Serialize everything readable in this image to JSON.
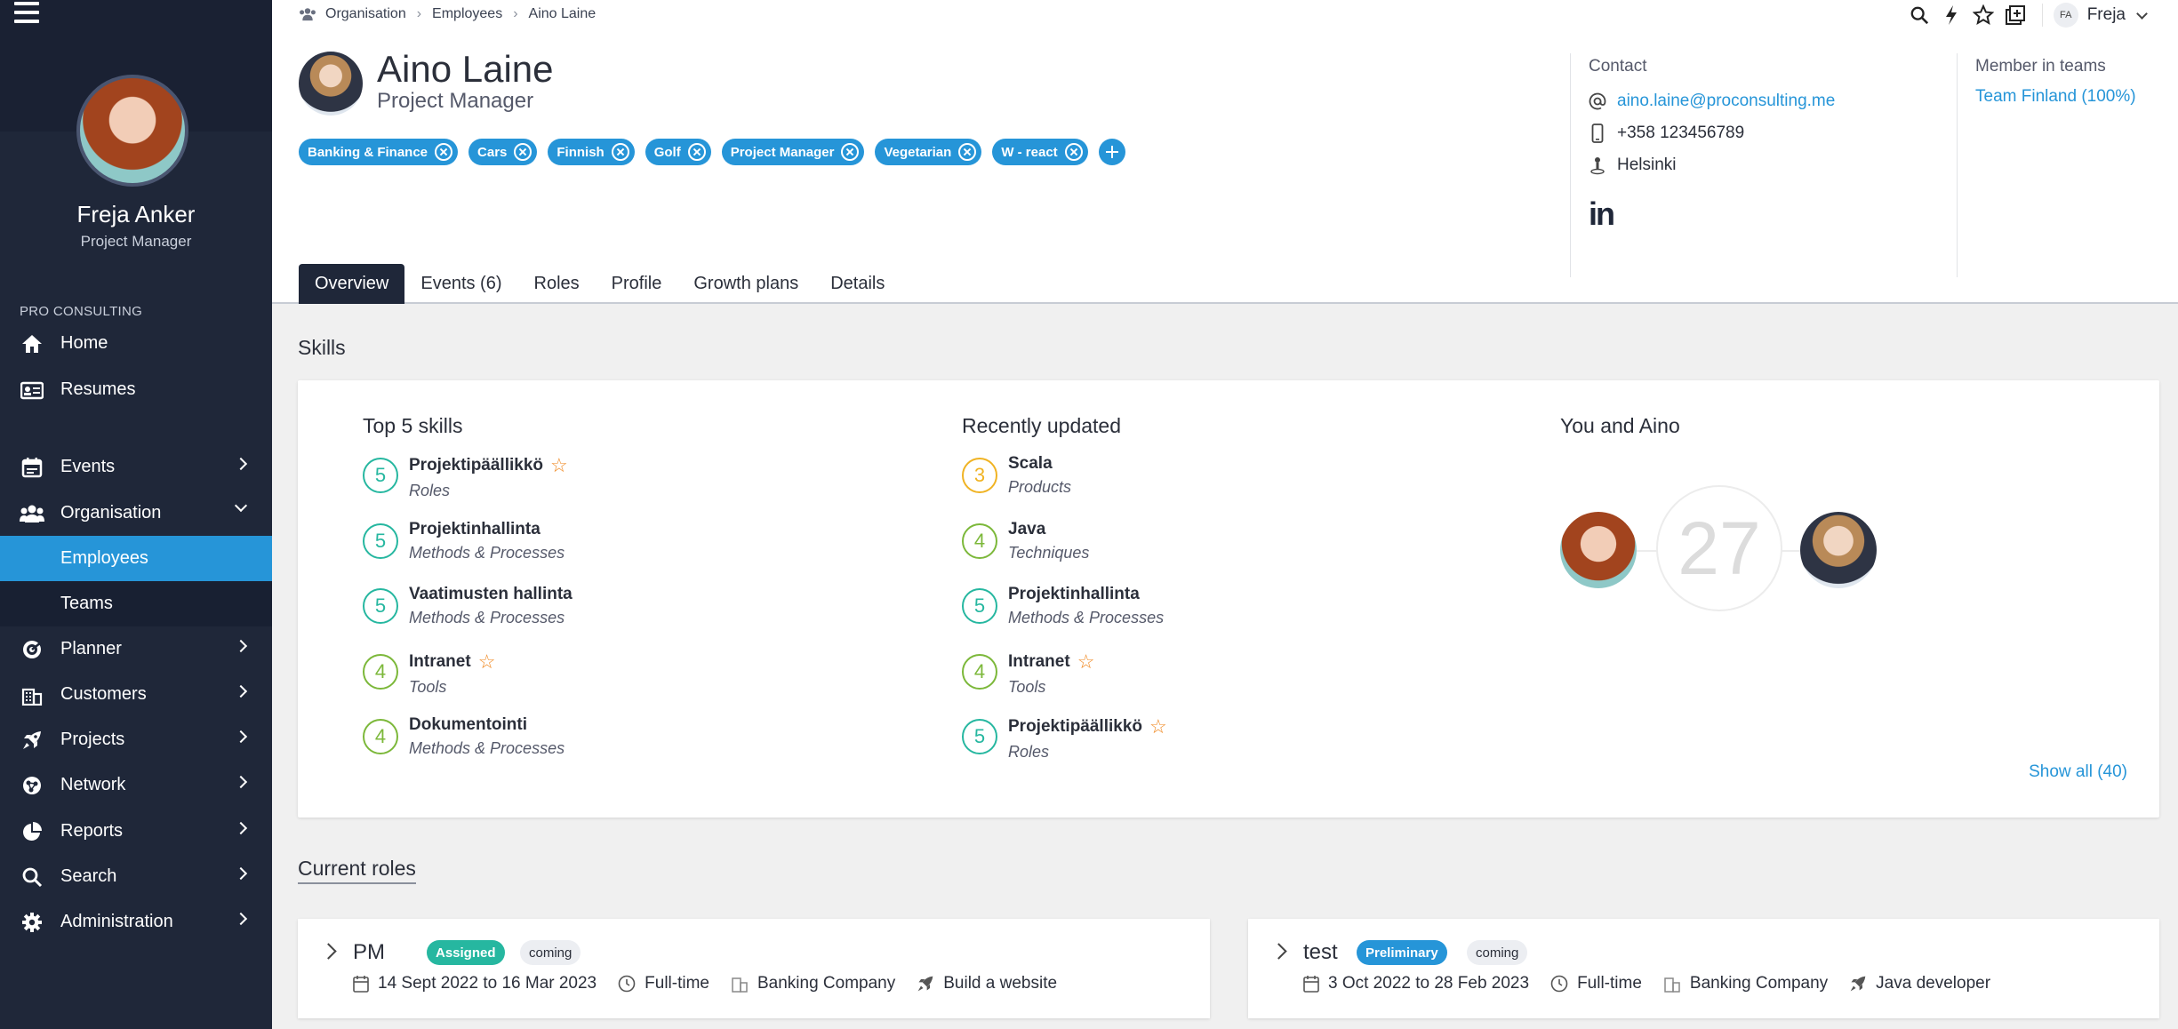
{
  "sidebar": {
    "user_name": "Freja Anker",
    "user_title": "Project Manager",
    "org_label": "PRO CONSULTING",
    "items": [
      {
        "label": "Home"
      },
      {
        "label": "Resumes"
      },
      {
        "label": "Events"
      },
      {
        "label": "Organisation"
      },
      {
        "label": "Employees"
      },
      {
        "label": "Teams"
      },
      {
        "label": "Planner"
      },
      {
        "label": "Customers"
      },
      {
        "label": "Projects"
      },
      {
        "label": "Network"
      },
      {
        "label": "Reports"
      },
      {
        "label": "Search"
      },
      {
        "label": "Administration"
      }
    ]
  },
  "topbar": {
    "breadcrumb": [
      "Organisation",
      "Employees",
      "Aino Laine"
    ],
    "user_initials": "FA",
    "user_name": "Freja"
  },
  "profile": {
    "name": "Aino Laine",
    "role": "Project Manager",
    "tags": [
      "Banking & Finance",
      "Cars",
      "Finnish",
      "Golf",
      "Project Manager",
      "Vegetarian",
      "W - react"
    ],
    "contact": {
      "heading": "Contact",
      "email": "aino.laine@proconsulting.me",
      "phone": "+358 123456789",
      "location": "Helsinki",
      "linkedin": "in"
    },
    "teams": {
      "heading": "Member in teams",
      "team": "Team Finland (100%)"
    }
  },
  "tabs": [
    "Overview",
    "Events (6)",
    "Roles",
    "Profile",
    "Growth plans",
    "Details"
  ],
  "skills": {
    "section_title": "Skills",
    "top5": {
      "title": "Top 5 skills",
      "items": [
        {
          "level": "5",
          "name": "Projektipäällikkö",
          "category": "Roles",
          "starred": true
        },
        {
          "level": "5",
          "name": "Projektinhallinta",
          "category": "Methods & Processes",
          "starred": false
        },
        {
          "level": "5",
          "name": "Vaatimusten hallinta",
          "category": "Methods & Processes",
          "starred": false
        },
        {
          "level": "4",
          "name": "Intranet",
          "category": "Tools",
          "starred": true
        },
        {
          "level": "4",
          "name": "Dokumentointi",
          "category": "Methods & Processes",
          "starred": false
        }
      ]
    },
    "recent": {
      "title": "Recently updated",
      "items": [
        {
          "level": "3",
          "name": "Scala",
          "category": "Products",
          "starred": false
        },
        {
          "level": "4",
          "name": "Java",
          "category": "Techniques",
          "starred": false
        },
        {
          "level": "5",
          "name": "Projektinhallinta",
          "category": "Methods & Processes",
          "starred": false
        },
        {
          "level": "4",
          "name": "Intranet",
          "category": "Tools",
          "starred": true
        },
        {
          "level": "5",
          "name": "Projektipäällikkö",
          "category": "Roles",
          "starred": true
        }
      ]
    },
    "you_and": {
      "title": "You and Aino",
      "shared_count": "27"
    },
    "show_all": "Show all (40)"
  },
  "roles": {
    "section_title": "Current roles",
    "cards": [
      {
        "name": "PM",
        "status": "Assigned",
        "timing": "coming",
        "dates": "14 Sept 2022 to 16 Mar 2023",
        "allocation": "Full-time",
        "customer": "Banking Company",
        "project": "Build a website"
      },
      {
        "name": "test",
        "status": "Preliminary",
        "timing": "coming",
        "dates": "3 Oct 2022 to 28 Feb 2023",
        "allocation": "Full-time",
        "customer": "Banking Company",
        "project": "Java developer"
      }
    ]
  },
  "colors": {
    "sidebar": "#1f2739",
    "accent": "#2695d8",
    "level5": "#26b7a0",
    "level4": "#7cb83a",
    "level3": "#f0b323",
    "star": "#f08a24"
  }
}
